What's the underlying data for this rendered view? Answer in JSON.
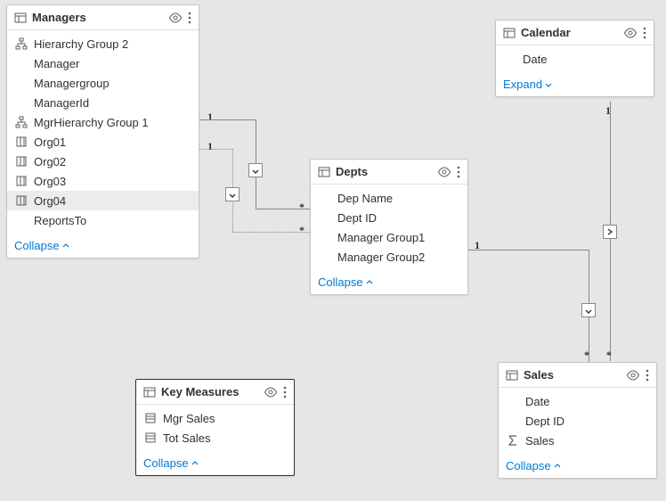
{
  "tables": {
    "managers": {
      "title": "Managers",
      "fields": [
        {
          "kind": "hierarchy",
          "label": "Hierarchy Group 2"
        },
        {
          "kind": "indent",
          "label": "Manager"
        },
        {
          "kind": "indent",
          "label": "Managergroup"
        },
        {
          "kind": "indent",
          "label": "ManagerId"
        },
        {
          "kind": "hierarchy",
          "label": "MgrHierarchy Group 1"
        },
        {
          "kind": "column",
          "label": "Org01"
        },
        {
          "kind": "column",
          "label": "Org02"
        },
        {
          "kind": "column",
          "label": "Org03"
        },
        {
          "kind": "column",
          "label": "Org04",
          "selected": true
        },
        {
          "kind": "indent",
          "label": "ReportsTo"
        }
      ],
      "action": "Collapse"
    },
    "calendar": {
      "title": "Calendar",
      "fields": [
        {
          "kind": "indent",
          "label": "Date"
        }
      ],
      "action": "Expand"
    },
    "depts": {
      "title": "Depts",
      "fields": [
        {
          "kind": "indent",
          "label": "Dep Name"
        },
        {
          "kind": "indent",
          "label": "Dept ID"
        },
        {
          "kind": "indent",
          "label": "Manager Group1"
        },
        {
          "kind": "indent",
          "label": "Manager Group2"
        }
      ],
      "action": "Collapse"
    },
    "keymeasures": {
      "title": "Key Measures",
      "selected": true,
      "fields": [
        {
          "kind": "measure",
          "label": "Mgr Sales"
        },
        {
          "kind": "measure",
          "label": "Tot Sales"
        }
      ],
      "action": "Collapse"
    },
    "sales": {
      "title": "Sales",
      "fields": [
        {
          "kind": "indent",
          "label": "Date"
        },
        {
          "kind": "indent",
          "label": "Dept ID"
        },
        {
          "kind": "sigma",
          "label": "Sales"
        }
      ],
      "action": "Collapse"
    }
  },
  "relations": {
    "managers_depts_solid": {
      "from_card": "1",
      "to_card": "*"
    },
    "managers_depts_dotted": {
      "from_card": "1",
      "to_card": "*"
    },
    "calendar_sales": {
      "from_card": "1",
      "to_card": "*"
    },
    "depts_sales": {
      "from_card": "1",
      "to_card": "*"
    }
  }
}
